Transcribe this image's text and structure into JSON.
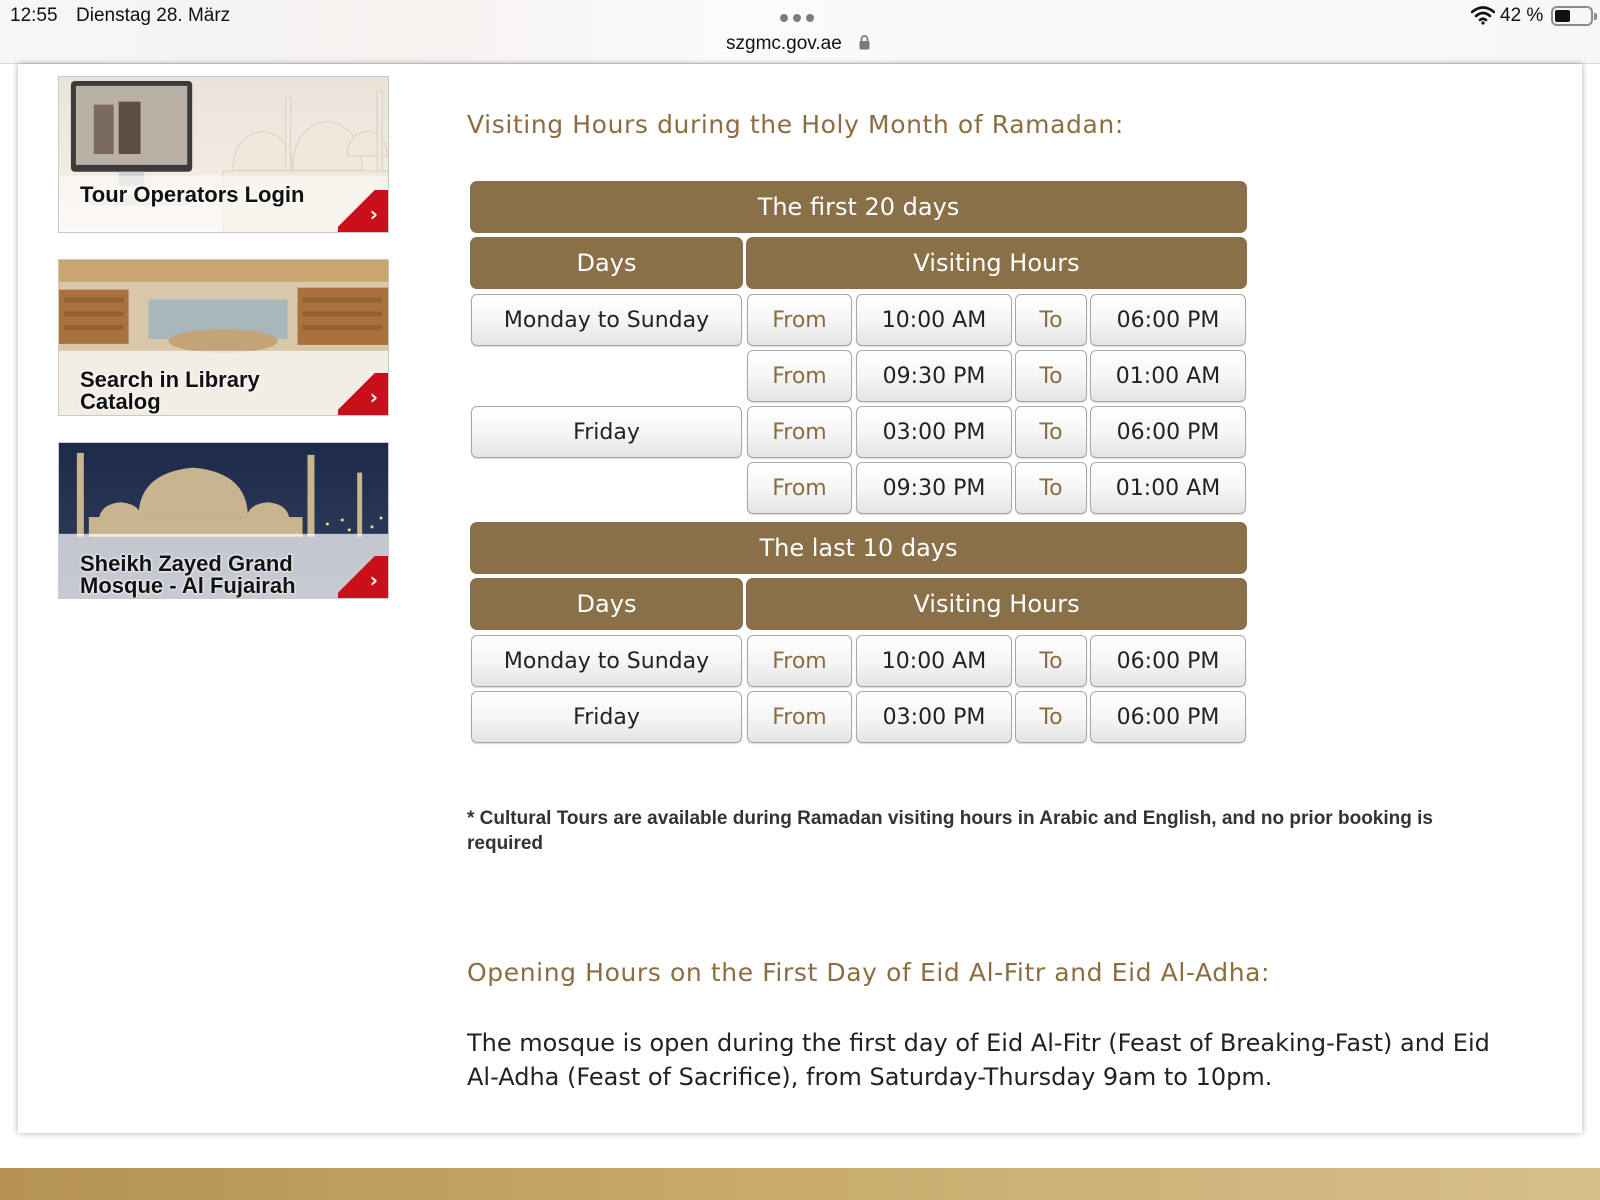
{
  "status_bar": {
    "time": "12:55",
    "date": "Dienstag 28. März",
    "url": "szgmc.gov.ae",
    "battery": "42 %",
    "battery_level": 0.42
  },
  "sidebar": {
    "tiles": [
      {
        "label": "Tour Operators Login",
        "icon": "chevron-right-icon"
      },
      {
        "label": "Search in Library Catalog",
        "icon": "chevron-right-icon"
      },
      {
        "label": "Sheikh Zayed Grand Mosque - Al Fujairah",
        "icon": "chevron-right-icon"
      }
    ],
    "tile_lines": [
      [
        "Tour Operators Login"
      ],
      [
        "Search in Library",
        "Catalog"
      ],
      [
        "Sheikh Zayed Grand",
        "Mosque - Al Fujairah"
      ]
    ]
  },
  "ramadan": {
    "heading": "Visiting Hours during the Holy Month of Ramadan:",
    "blocks": [
      {
        "title": "The first 20 days",
        "col_days": "Days",
        "col_hours": "Visiting Hours",
        "rows": [
          {
            "day": "Monday to Sunday",
            "from_label": "From",
            "from": "10:00 AM",
            "to_label": "To",
            "to": "06:00 PM"
          },
          {
            "day": "",
            "from_label": "From",
            "from": "09:30 PM",
            "to_label": "To",
            "to": "01:00 AM"
          },
          {
            "day": "Friday",
            "from_label": "From",
            "from": "03:00 PM",
            "to_label": "To",
            "to": "06:00 PM"
          },
          {
            "day": "",
            "from_label": "From",
            "from": "09:30 PM",
            "to_label": "To",
            "to": "01:00 AM"
          }
        ]
      },
      {
        "title": "The last 10 days",
        "col_days": "Days",
        "col_hours": "Visiting Hours",
        "rows": [
          {
            "day": "Monday to Sunday",
            "from_label": "From",
            "from": "10:00 AM",
            "to_label": "To",
            "to": "06:00 PM"
          },
          {
            "day": "Friday",
            "from_label": "From",
            "from": "03:00 PM",
            "to_label": "To",
            "to": "06:00 PM"
          }
        ]
      }
    ],
    "note": "* Cultural Tours are available during Ramadan visiting hours in Arabic and English, and no prior booking is required"
  },
  "eid": {
    "heading": "Opening Hours on the First Day of Eid Al-Fitr and Eid Al-Adha:",
    "text": "The mosque is open during the first day of Eid Al-Fitr (Feast of Breaking-Fast) and Eid Al-Adha (Feast of Sacrifice), from Saturday-Thursday 9am to 10pm."
  },
  "colors": {
    "header_brown": "#8a7048",
    "heading_gold": "#8c6d42",
    "arrow_red": "#c9101a",
    "footer_gold": "#b99a5a"
  }
}
